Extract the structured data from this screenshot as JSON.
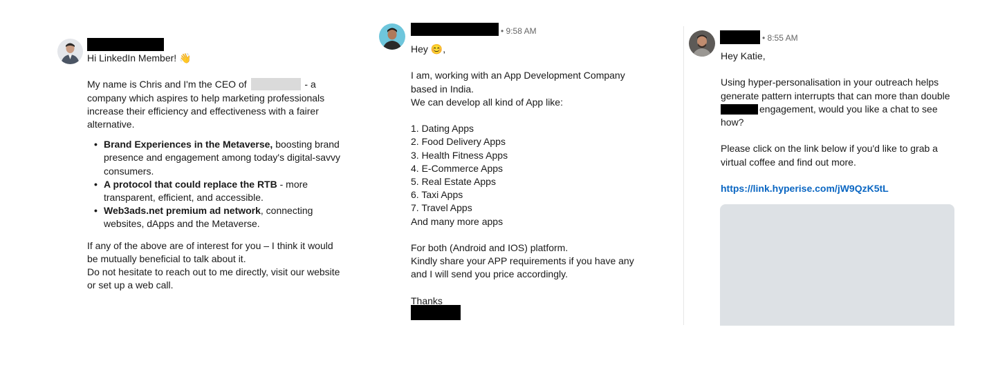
{
  "colors": {
    "link": "#0a66c2",
    "placeholder": "#dde1e5",
    "timestamp": "#666666"
  },
  "message1": {
    "greeting": "Hi LinkedIn Member! 👋",
    "intro_a": "My name is Chris and I'm the CEO of",
    "intro_b": "- a company which aspires to help marketing professionals increase their efficiency and effectiveness with a fairer alternative.",
    "bullets": [
      {
        "bold": "Brand Experiences in the Metaverse,",
        "rest": " boosting brand presence and engagement among today's digital-savvy consumers."
      },
      {
        "bold": "A protocol that could replace the RTB",
        "rest": " - more transparent, efficient, and accessible."
      },
      {
        "bold": "Web3ads.net premium ad network",
        "rest": ", connecting websites, dApps and the Metaverse."
      }
    ],
    "closing_1": "If any of the above are of interest for you – I think it would be mutually beneficial to talk about it.",
    "closing_2": "Do not hesitate to reach out to me directly, visit our website or set up a web call."
  },
  "message2": {
    "time": "• 9:58 AM",
    "greeting": "Hey 😊,",
    "lines_a": [
      "I am, working with an App Development Company",
      "based in India.",
      "We can develop all kind of App like:"
    ],
    "apps": [
      "1. Dating Apps",
      "2. Food Delivery Apps",
      "3. Health Fitness Apps",
      "4. E-Commerce Apps",
      "5. Real Estate Apps",
      "6. Taxi Apps",
      "7. Travel Apps",
      "And many more apps"
    ],
    "lines_b": [
      "For both (Android and IOS) platform.",
      "Kindly share your APP requirements if you have any",
      "and I will send you price accordingly."
    ],
    "thanks": "Thanks"
  },
  "message3": {
    "time": "• 8:55 AM",
    "greeting": "Hey Katie,",
    "para1_a": "Using hyper-personalisation in your outreach helps generate pattern interrupts that can more than double",
    "para1_b": "engagement, would you like a chat to see how?",
    "para2": "Please click on the link below if you'd like to grab a virtual coffee and find out more.",
    "link": "https://link.hyperise.com/jW9QzK5tL"
  }
}
